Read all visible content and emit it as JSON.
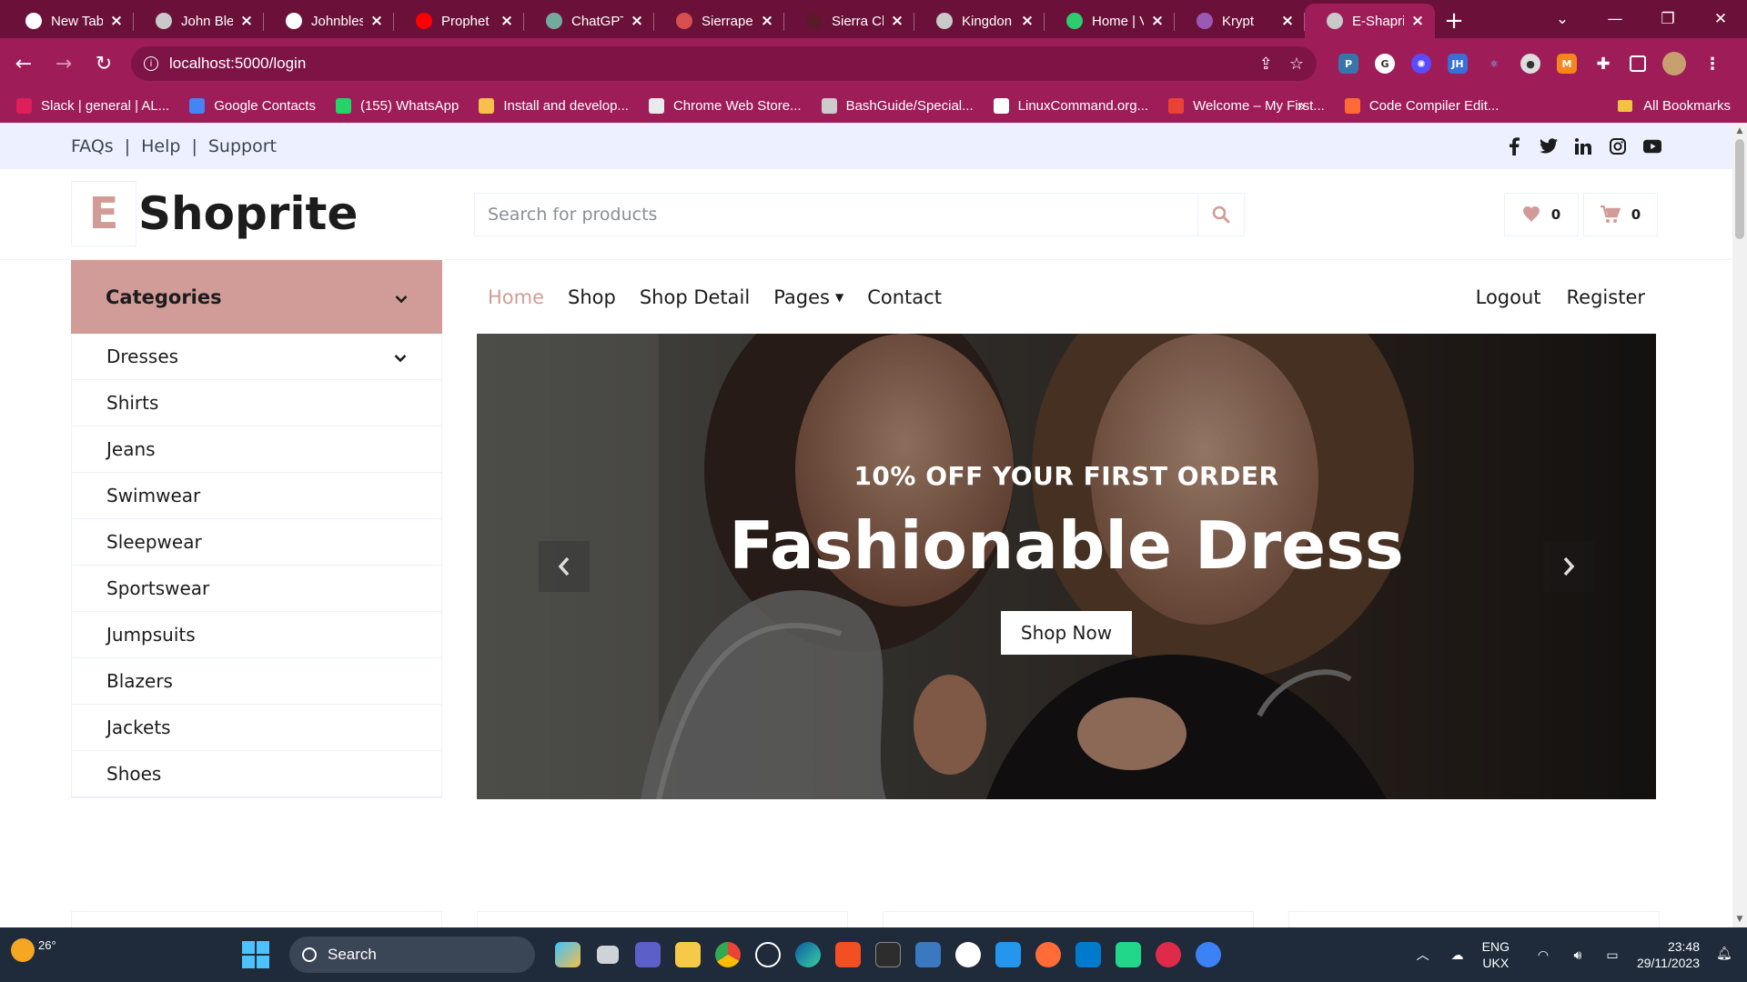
{
  "browser": {
    "tabs": [
      {
        "title": "New Tab",
        "favicon_color": "#ffffff"
      },
      {
        "title": "John Ble",
        "favicon_color": "#c9c9c9"
      },
      {
        "title": "Johnbles",
        "favicon_color": "#ffffff"
      },
      {
        "title": "Prophet",
        "favicon_color": "#ff0000"
      },
      {
        "title": "ChatGPT",
        "favicon_color": "#74aa9c"
      },
      {
        "title": "Sierrape",
        "favicon_color": "#d94f4f"
      },
      {
        "title": "Sierra Ch",
        "favicon_color": "#5a1a2a"
      },
      {
        "title": "Kingdon",
        "favicon_color": "#c9c9c9"
      },
      {
        "title": "Home | V",
        "favicon_color": "#2ecc71"
      },
      {
        "title": "Krypt",
        "favicon_color": "#9b59b6"
      },
      {
        "title": "E-Shapri",
        "favicon_color": "#c9c9c9"
      }
    ],
    "new_tab_symbol": "+",
    "url": "localhost:5000/login",
    "bookmarks": [
      {
        "label": "Slack | general | AL...",
        "color": "#e01e5a"
      },
      {
        "label": "Google Contacts",
        "color": "#4285f4"
      },
      {
        "label": "(155) WhatsApp",
        "color": "#25d366"
      },
      {
        "label": "Install and develop...",
        "color": "#f7c04a"
      },
      {
        "label": "Chrome Web Store...",
        "color": "#e8eaed"
      },
      {
        "label": "BashGuide/Special...",
        "color": "#cccccc"
      },
      {
        "label": "LinuxCommand.org...",
        "color": "#ffffff"
      },
      {
        "label": "Welcome – My First...",
        "color": "#ea4335"
      },
      {
        "label": "Code Compiler Edit...",
        "color": "#ff6b35"
      }
    ],
    "bookmarks_more": "»",
    "all_bookmarks": "All Bookmarks"
  },
  "page": {
    "topbar": {
      "links": [
        "FAQs",
        "Help",
        "Support"
      ],
      "separator": "|",
      "social_icons": [
        "facebook-icon",
        "twitter-icon",
        "linkedin-icon",
        "instagram-icon",
        "youtube-icon"
      ]
    },
    "header": {
      "logo_letter": "E",
      "logo_text": "Shoprite",
      "search_placeholder": "Search for products",
      "wishlist_count": "0",
      "cart_count": "0"
    },
    "categories": {
      "title": "Categories",
      "items": [
        "Dresses",
        "Shirts",
        "Jeans",
        "Swimwear",
        "Sleepwear",
        "Sportswear",
        "Jumpsuits",
        "Blazers",
        "Jackets",
        "Shoes"
      ]
    },
    "nav": {
      "left": [
        "Home",
        "Shop",
        "Shop Detail",
        "Pages",
        "Contact"
      ],
      "right": [
        "Logout",
        "Register"
      ],
      "active": "Home"
    },
    "hero": {
      "subtitle": "10% OFF YOUR FIRST ORDER",
      "title": "Fashionable Dress",
      "button": "Shop Now"
    },
    "colors": {
      "primary": "#d19c97",
      "secondary": "#edf1ff",
      "dark": "#1c1c1c"
    }
  },
  "taskbar": {
    "weather_temp": "26°",
    "search_label": "Search",
    "language": "ENG",
    "keyboard": "UKX",
    "time": "23:48",
    "date": "29/11/2023"
  }
}
